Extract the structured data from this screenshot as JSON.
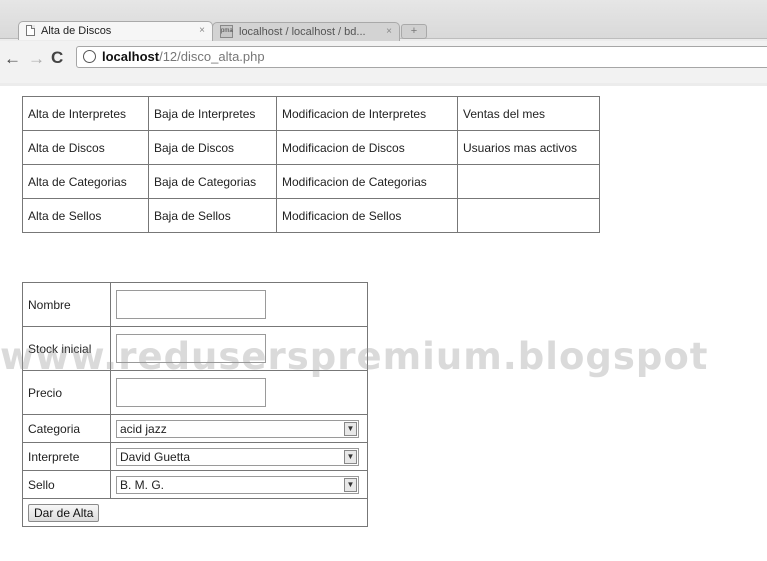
{
  "browser": {
    "tabs": [
      {
        "label": "Alta de Discos",
        "close": "×"
      },
      {
        "label": "localhost / localhost / bd...",
        "close": "×"
      }
    ],
    "url_host": "localhost",
    "url_path": "/12/disco_alta.php"
  },
  "menu": {
    "rows": [
      [
        "Alta de Interpretes",
        "Baja de Interpretes",
        "Modificacion de Interpretes",
        "Ventas del mes"
      ],
      [
        "Alta de Discos",
        "Baja de Discos",
        "Modificacion de Discos",
        "Usuarios mas activos"
      ],
      [
        "Alta de Categorias",
        "Baja de Categorias",
        "Modificacion de Categorias",
        ""
      ],
      [
        "Alta de Sellos",
        "Baja de Sellos",
        "Modificacion de Sellos",
        ""
      ]
    ]
  },
  "form": {
    "nombre_label": "Nombre",
    "stock_label": "Stock inicial",
    "precio_label": "Precio",
    "categoria_label": "Categoria",
    "categoria_value": "acid jazz",
    "interprete_label": "Interprete",
    "interprete_value": "David Guetta",
    "sello_label": "Sello",
    "sello_value": "B. M. G.",
    "submit_label": "Dar de Alta"
  },
  "watermark": "www.reduserspremium.blogspot"
}
